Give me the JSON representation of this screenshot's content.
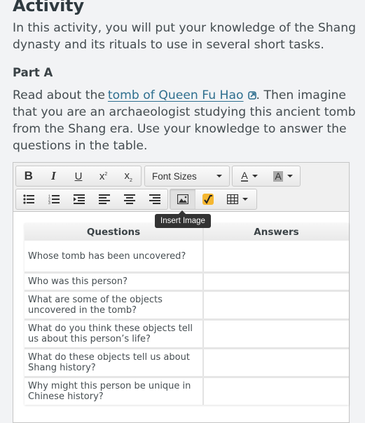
{
  "page": {
    "title": "Activity",
    "intro": "In this activity, you will put your knowledge of the Shang dynasty and its rituals to use in several short tasks."
  },
  "part_a": {
    "heading": "Part A",
    "text_before_link": "Read about the",
    "link_text": "tomb of Queen Fu Hao",
    "link_icon": "external-link-icon",
    "text_after_link": ". Then imagine that you are an archaeologist studying this ancient tomb from the Shang era. Use your knowledge to answer the questions in the table."
  },
  "toolbar": {
    "row1": [
      {
        "name": "bold-button",
        "icon": "bold-icon"
      },
      {
        "name": "italic-button",
        "icon": "italic-icon"
      },
      {
        "name": "underline-button",
        "icon": "underline-icon"
      },
      {
        "name": "superscript-button",
        "icon": "superscript-icon"
      },
      {
        "name": "subscript-button",
        "icon": "subscript-icon"
      }
    ],
    "font_sizes_label": "Font Sizes",
    "text_color_icon": "text-color-icon",
    "background_color_icon": "background-color-icon",
    "row2": [
      {
        "name": "bullet-list-button",
        "icon": "bullet-list-icon"
      },
      {
        "name": "numbered-list-button",
        "icon": "numbered-list-icon"
      },
      {
        "name": "indent-button",
        "icon": "indent-icon"
      },
      {
        "name": "align-left-button",
        "icon": "align-left-icon"
      },
      {
        "name": "align-center-button",
        "icon": "align-center-icon"
      },
      {
        "name": "align-right-button",
        "icon": "align-right-icon"
      }
    ],
    "insert_image_icon": "image-icon",
    "equation_icon": "square-root-icon",
    "table_icon": "table-icon",
    "tooltip": "Insert Image",
    "accent_color": "#f5b731"
  },
  "table": {
    "headers": [
      "Questions",
      "Answers"
    ],
    "rows": [
      {
        "question": "Whose tomb has been uncovered?",
        "answer": ""
      },
      {
        "question": "Who was this person?",
        "answer": ""
      },
      {
        "question": "What are some of the objects uncovered in the tomb?",
        "answer": ""
      },
      {
        "question": "What do you think these objects tell us about this person’s life?",
        "answer": ""
      },
      {
        "question": "What do these objects tell us about Shang history?",
        "answer": ""
      },
      {
        "question": "Why might this person be unique in Chinese history?",
        "answer": ""
      }
    ]
  }
}
